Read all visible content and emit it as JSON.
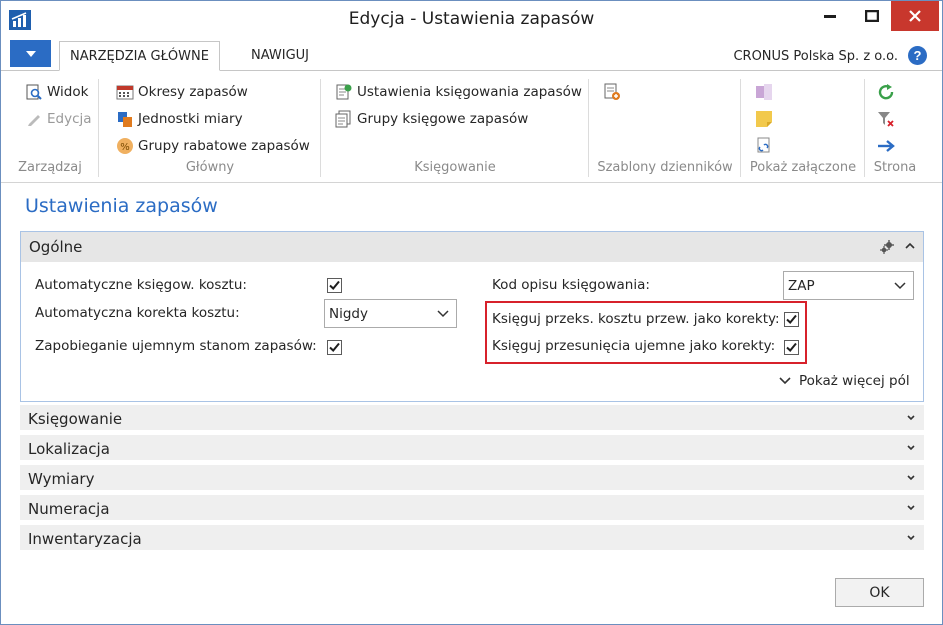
{
  "window": {
    "title": "Edycja - Ustawienia zapasów",
    "company": "CRONUS Polska Sp. z o.o.",
    "help_label": "?"
  },
  "ribbon": {
    "tabs": [
      {
        "label": "NARZĘDZIA GŁÓWNE",
        "active": true
      },
      {
        "label": "NAWIGUJ",
        "active": false
      }
    ],
    "groups": {
      "manage": {
        "label": "Zarządzaj",
        "items": [
          {
            "label": "Widok",
            "icon": "view-icon",
            "enabled": true
          },
          {
            "label": "Edycja",
            "icon": "edit-icon",
            "enabled": false
          }
        ]
      },
      "main": {
        "label": "Główny",
        "items": [
          {
            "label": "Okresy zapasów",
            "icon": "calendar-icon"
          },
          {
            "label": "Jednostki miary",
            "icon": "units-icon"
          },
          {
            "label": "Grupy rabatowe zapasów",
            "icon": "discount-icon"
          }
        ]
      },
      "posting": {
        "label": "Księgowanie",
        "items": [
          {
            "label": "Ustawienia księgowania zapasów",
            "icon": "posting-setup-icon"
          },
          {
            "label": "Grupy księgowe zapasów",
            "icon": "posting-groups-icon"
          }
        ]
      },
      "journal_templates": {
        "label": "Szablony dzienników",
        "icon": "journal-template-icon"
      },
      "attachments": {
        "label": "Pokaż załączone",
        "icons": [
          "onenote-icon",
          "note-icon",
          "links-icon"
        ]
      },
      "page": {
        "label": "Strona",
        "icons": [
          "refresh-icon",
          "clear-filter-icon",
          "go-to-icon"
        ]
      }
    }
  },
  "page": {
    "title": "Ustawienia zapasów",
    "general": {
      "title": "Ogólne",
      "fields": {
        "auto_cost_posting": {
          "label": "Automatyczne księgow. kosztu:",
          "checked": true
        },
        "auto_cost_adjustment": {
          "label": "Automatyczna korekta kosztu:",
          "value": "Nigdy"
        },
        "prevent_negative_inventory": {
          "label": "Zapobieganie ujemnym stanom zapasów:",
          "checked": true
        },
        "posting_description_code": {
          "label": "Kod opisu księgowania:",
          "value": "ZAP"
        },
        "post_cost_transfer_as_correction": {
          "label": "Księguj przeks. kosztu przew. jako korekty:",
          "checked": true
        },
        "post_negative_transfers_as_correction": {
          "label": "Księguj przesunięcia ujemne jako korekty:",
          "checked": true
        }
      },
      "show_more": "Pokaż więcej pól"
    },
    "sections": [
      "Księgowanie",
      "Lokalizacja",
      "Wymiary",
      "Numeracja",
      "Inwentaryzacja"
    ],
    "ok_label": "OK"
  },
  "colors": {
    "accent": "#2b6cc4",
    "highlight": "#d7212b",
    "close": "#c8372d"
  }
}
